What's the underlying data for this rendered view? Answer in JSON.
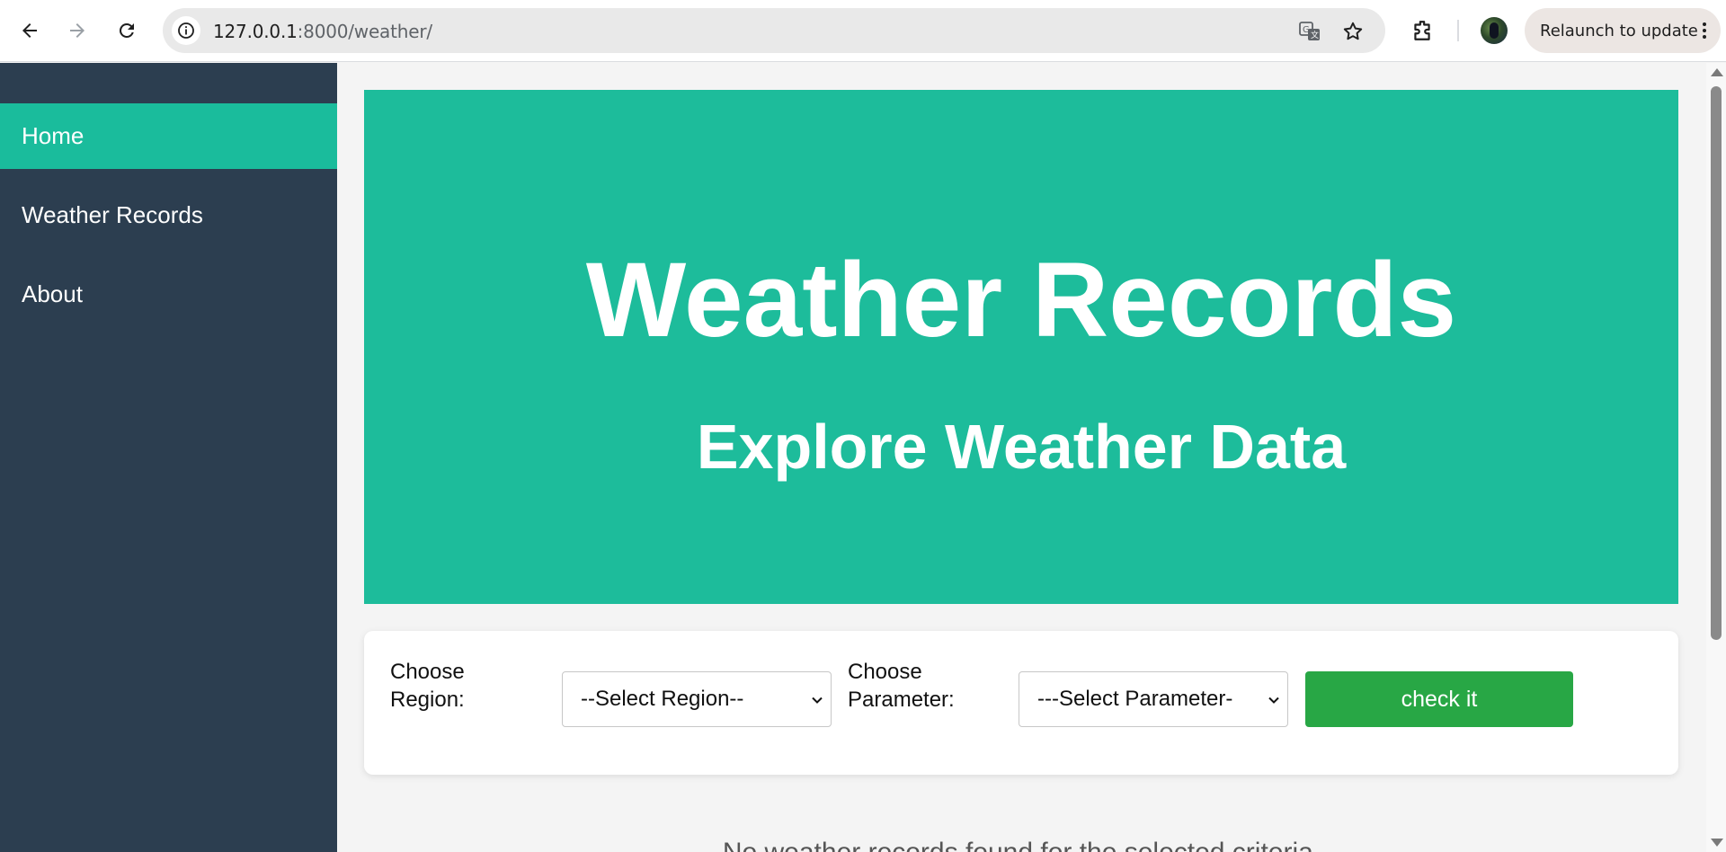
{
  "browser": {
    "url_host": "127.0.0.1",
    "url_path": ":8000/weather/",
    "relaunch_label": "Relaunch to update",
    "icons": [
      "back-arrow-icon",
      "forward-arrow-icon",
      "reload-icon",
      "site-info-icon",
      "translate-icon",
      "bookmark-star-icon",
      "extensions-icon",
      "profile-avatar",
      "kebab-menu-icon"
    ]
  },
  "sidebar": {
    "items": [
      {
        "label": "Home",
        "active": true
      },
      {
        "label": "Weather Records",
        "active": false
      },
      {
        "label": "About",
        "active": false
      }
    ]
  },
  "hero": {
    "title": "Weather Records",
    "subtitle": "Explore Weather Data"
  },
  "form": {
    "region_label": "Choose Region:",
    "region_selected": "--Select Region--",
    "parameter_label": "Choose Parameter:",
    "parameter_selected": "---Select Parameter-",
    "submit_label": "check it"
  },
  "message": "No weather records found for the selected criteria.",
  "colors": {
    "sidebar_bg": "#2c3e50",
    "accent": "#1abc9c",
    "hero_bg": "#1dbc9b",
    "button_bg": "#28a745"
  }
}
